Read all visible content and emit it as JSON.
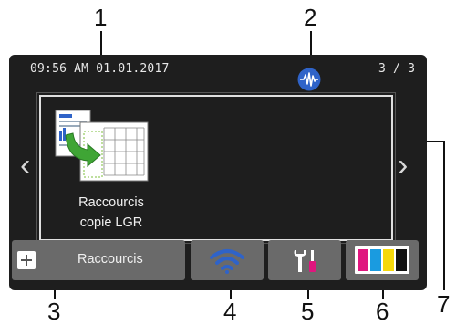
{
  "callouts": [
    "1",
    "2",
    "3",
    "4",
    "5",
    "6",
    "7"
  ],
  "status_bar": {
    "datetime": "09:56 AM  01.01.2017",
    "page_indicator": "3 / 3",
    "network_icon": "wired-lan-icon"
  },
  "shortcut_card": {
    "icon": "copy-shortcut-icon",
    "label_line1": "Raccourcis",
    "label_line2": "copie LGR"
  },
  "buttons": {
    "shortcuts_label": "Raccourcis",
    "wifi_icon": "wifi-icon",
    "settings_icon": "settings-tools-icon",
    "ink_icon": "ink-levels-icon"
  },
  "colors": {
    "screen_bg": "#1e1e1e",
    "button_bg": "#6a6a6a",
    "net_icon": "#2f63c8",
    "wifi": "#2f63c8",
    "ink_magenta": "#e0167e",
    "ink_cyan": "#1a9be0",
    "ink_yellow": "#f5d80c",
    "ink_black": "#111111"
  }
}
